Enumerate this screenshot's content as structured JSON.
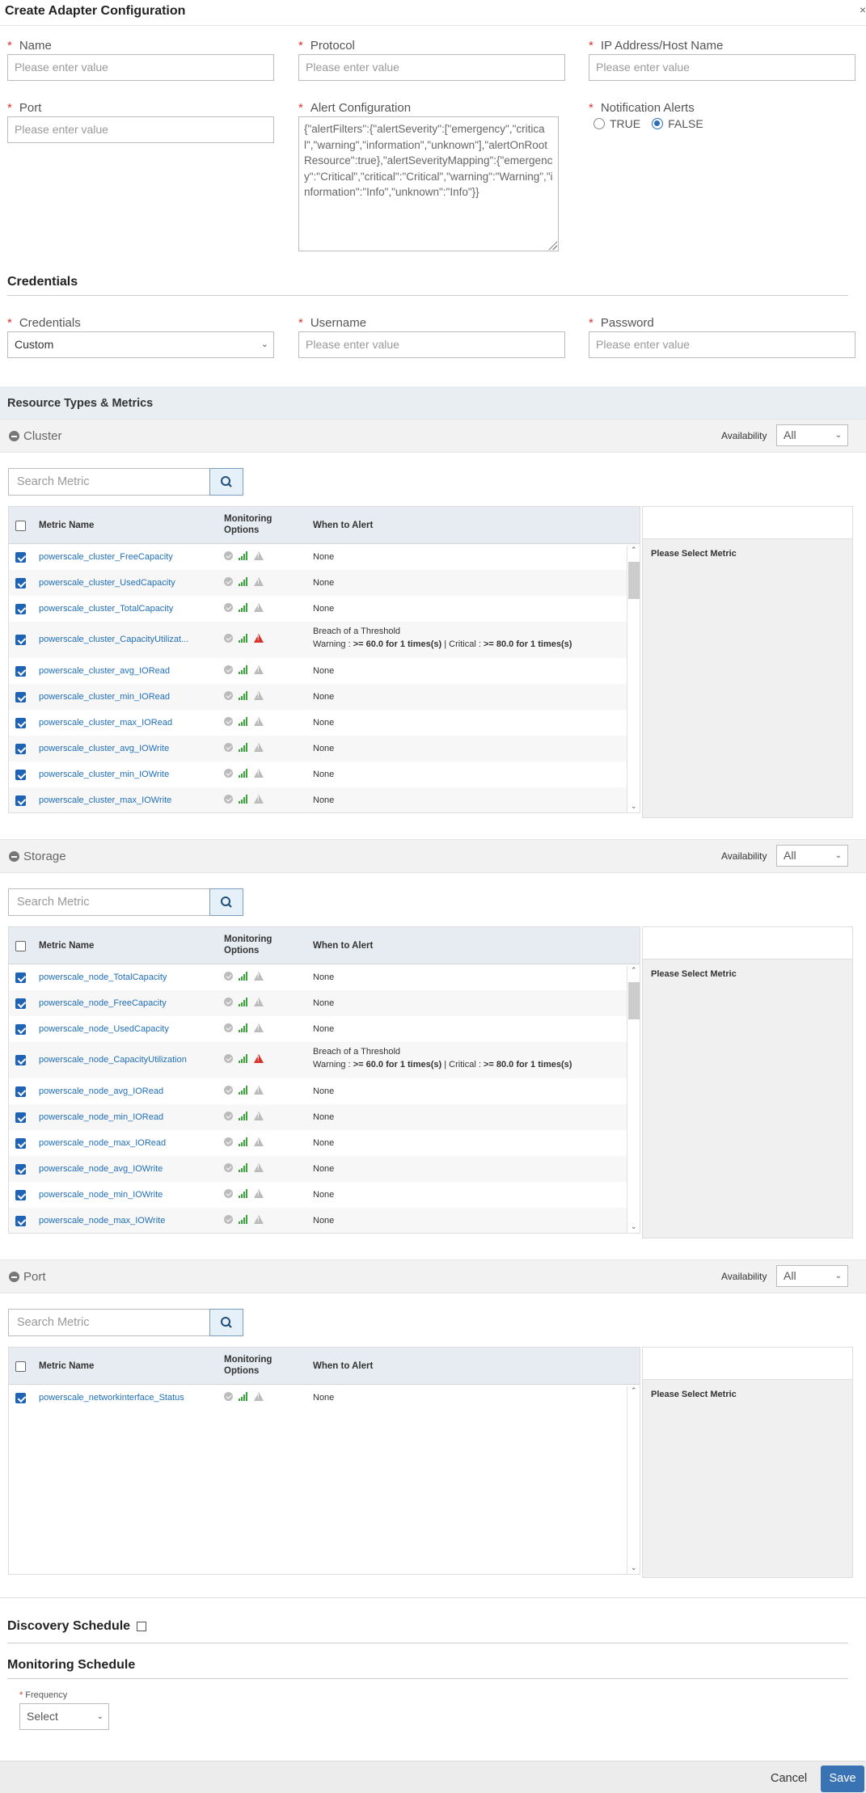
{
  "dialog": {
    "title": "Create Adapter Configuration",
    "close": "×"
  },
  "fields": {
    "name": {
      "label": "Name",
      "placeholder": "Please enter value"
    },
    "protocol": {
      "label": "Protocol",
      "placeholder": "Please enter value"
    },
    "ip": {
      "label": "IP Address/Host Name",
      "placeholder": "Please enter value"
    },
    "port": {
      "label": "Port",
      "placeholder": "Please enter value"
    },
    "alert_config": {
      "label": "Alert Configuration",
      "value": "{\"alertFilters\":{\"alertSeverity\":[\"emergency\",\"critical\",\"warning\",\"information\",\"unknown\"],\"alertOnRootResource\":true},\"alertSeverityMapping\":{\"emergency\":\"Critical\",\"critical\":\"Critical\",\"warning\":\"Warning\",\"information\":\"Info\",\"unknown\":\"Info\"}}"
    },
    "notification": {
      "label": "Notification Alerts",
      "options": [
        "TRUE",
        "FALSE"
      ],
      "selected": "FALSE"
    }
  },
  "credentials_section": {
    "title": "Credentials",
    "credentials": {
      "label": "Credentials",
      "value": "Custom"
    },
    "username": {
      "label": "Username",
      "placeholder": "Please enter value"
    },
    "password": {
      "label": "Password",
      "placeholder": "Please enter value"
    }
  },
  "resource_section": {
    "title": "Resource Types & Metrics"
  },
  "availability_label": "Availability",
  "search_placeholder": "Search Metric",
  "table_headers": {
    "metric": "Metric Name",
    "monitoring": "Monitoring Options",
    "when": "When to Alert"
  },
  "side_message": "Please Select Metric",
  "groups": [
    {
      "name": "Cluster",
      "availability": "All",
      "metrics": [
        {
          "name": "powerscale_cluster_FreeCapacity",
          "when": "None"
        },
        {
          "name": "powerscale_cluster_UsedCapacity",
          "when": "None"
        },
        {
          "name": "powerscale_cluster_TotalCapacity",
          "when": "None"
        },
        {
          "name": "powerscale_cluster_CapacityUtilizat...",
          "when": "Breach of a Threshold",
          "warning": ">= 60.0 for 1 times(s)",
          "critical": ">= 80.0 for 1 times(s)"
        },
        {
          "name": "powerscale_cluster_avg_IORead",
          "when": "None"
        },
        {
          "name": "powerscale_cluster_min_IORead",
          "when": "None"
        },
        {
          "name": "powerscale_cluster_max_IORead",
          "when": "None"
        },
        {
          "name": "powerscale_cluster_avg_IOWrite",
          "when": "None"
        },
        {
          "name": "powerscale_cluster_min_IOWrite",
          "when": "None"
        },
        {
          "name": "powerscale_cluster_max_IOWrite",
          "when": "None"
        }
      ]
    },
    {
      "name": "Storage",
      "availability": "All",
      "metrics": [
        {
          "name": "powerscale_node_TotalCapacity",
          "when": "None"
        },
        {
          "name": "powerscale_node_FreeCapacity",
          "when": "None"
        },
        {
          "name": "powerscale_node_UsedCapacity",
          "when": "None"
        },
        {
          "name": "powerscale_node_CapacityUtilization",
          "when": "Breach of a Threshold",
          "warning": ">= 60.0 for 1 times(s)",
          "critical": ">= 80.0 for 1 times(s)"
        },
        {
          "name": "powerscale_node_avg_IORead",
          "when": "None"
        },
        {
          "name": "powerscale_node_min_IORead",
          "when": "None"
        },
        {
          "name": "powerscale_node_max_IORead",
          "when": "None"
        },
        {
          "name": "powerscale_node_avg_IOWrite",
          "when": "None"
        },
        {
          "name": "powerscale_node_min_IOWrite",
          "when": "None"
        },
        {
          "name": "powerscale_node_max_IOWrite",
          "when": "None"
        }
      ]
    },
    {
      "name": "Port",
      "availability": "All",
      "metrics": [
        {
          "name": "powerscale_networkinterface_Status",
          "when": "None"
        }
      ]
    }
  ],
  "threshold_labels": {
    "warning": "Warning :",
    "critical": "Critical :"
  },
  "discovery": {
    "title": "Discovery Schedule"
  },
  "monitoring": {
    "title": "Monitoring Schedule",
    "frequency_label": "Frequency",
    "frequency_value": "Select"
  },
  "footer": {
    "cancel": "Cancel",
    "save": "Save"
  },
  "colors": {
    "accent": "#3a73b4",
    "required": "#d9342b",
    "link": "#1f6eb8",
    "ok_green": "#3aa53a"
  }
}
